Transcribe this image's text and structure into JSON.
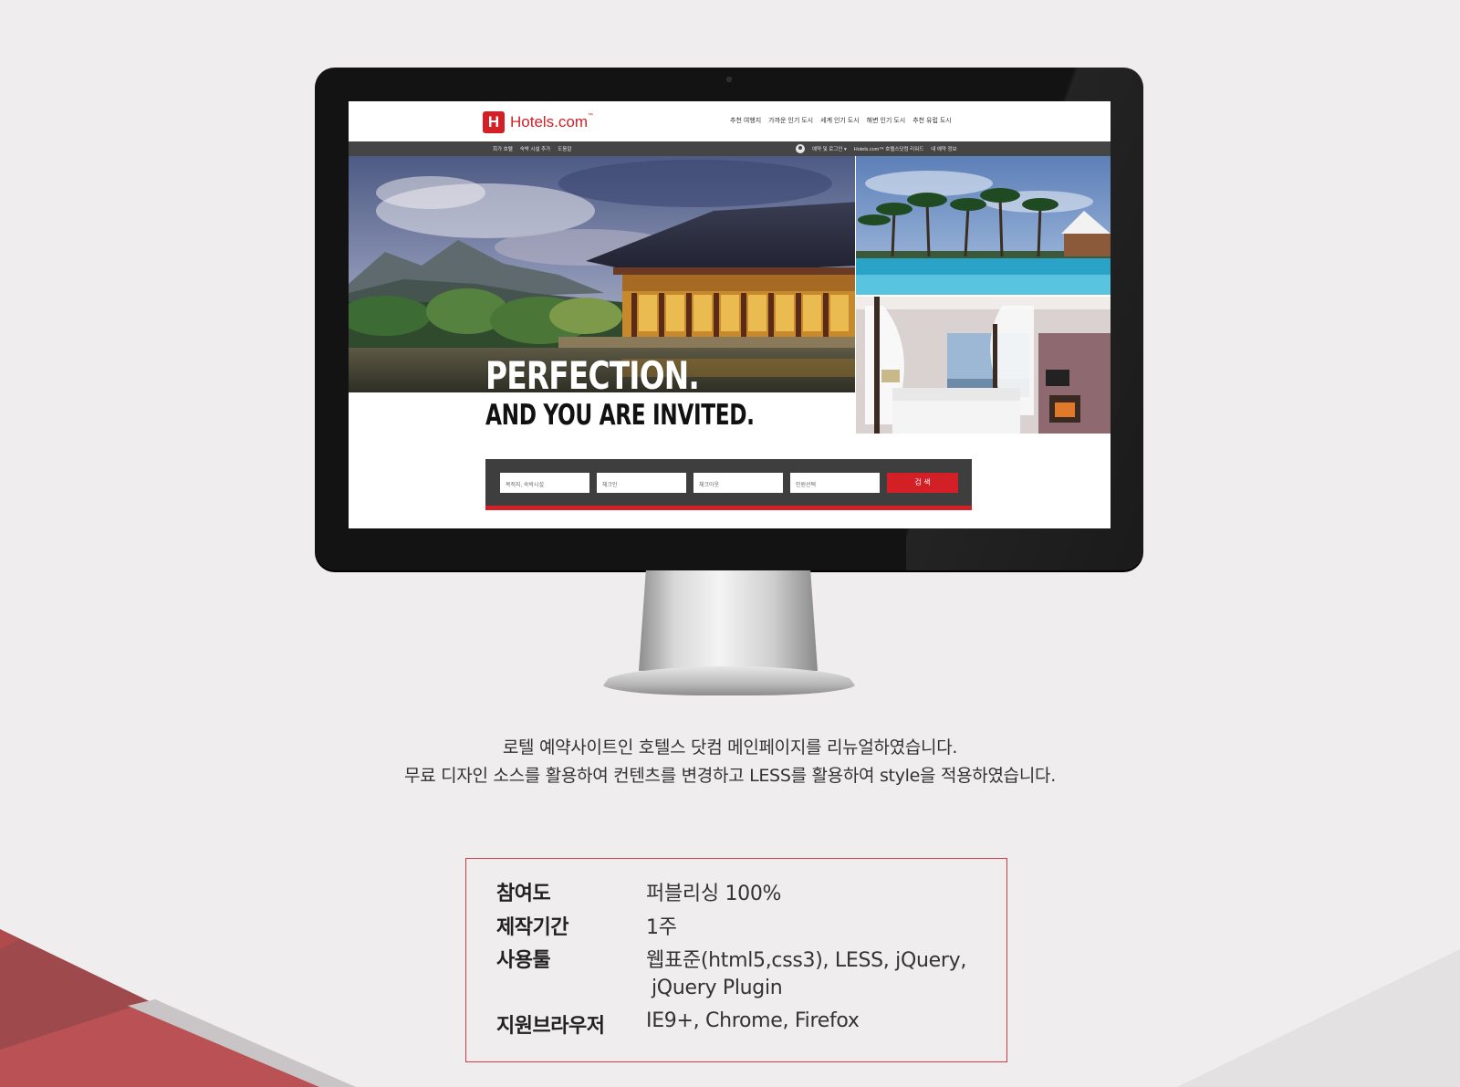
{
  "site": {
    "logo_mark": "H",
    "logo_text": "Hotels.com",
    "logo_tm": "™",
    "top_nav": [
      "추천 여행지",
      "가까운 인기 도시",
      "세계 인기 도시",
      "해변 인기 도시",
      "추천 유럽 도시"
    ],
    "sub_nav_left": [
      "회가 호텔",
      "숙박 시설 추가",
      "도움말"
    ],
    "sub_nav_right": [
      "예약 및 로그인 ▾",
      "Hotels.com™ 호텔스닷컴 리워드",
      "내 예약 정보"
    ],
    "hero_title": "PERFECTION.",
    "hero_subtitle": "AND YOU ARE INVITED.",
    "search": {
      "destination_placeholder": "목적지, 숙박시설",
      "checkin_placeholder": "체크인",
      "checkout_placeholder": "체크아웃",
      "guests_placeholder": "인원선택",
      "button_label": "검 색"
    }
  },
  "description": {
    "line1": "로텔 예약사이트인 호텔스 닷컴 메인페이지를 리뉴얼하였습니다.",
    "line2": "무료 디자인 소스를 활용하여 컨텐츠를 변경하고 LESS를 활용하여 style을 적용하였습니다."
  },
  "info": {
    "participation_label": "참여도",
    "participation_value": "퍼블리싱 100%",
    "period_label": "제작기간",
    "period_value": "1주",
    "tools_label": "사용툴",
    "tools_value_line1": "웹표준(html5,css3), LESS, jQuery,",
    "tools_value_line2": "jQuery Plugin",
    "browsers_label": "지원브라우저",
    "browsers_value": "IE9+, Chrome, Firefox"
  },
  "colors": {
    "brand_red": "#d32027",
    "background": "#efedee",
    "box_border": "#d23b43"
  }
}
